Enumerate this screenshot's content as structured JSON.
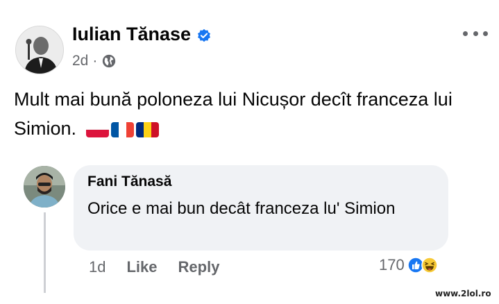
{
  "post": {
    "author": "Iulian Tănase",
    "time": "2d",
    "separator": "·",
    "text": "Mult mai bună poloneza lui Nicușor decît franceza lui Simion.",
    "flags": [
      "flag-poland-icon",
      "flag-france-icon",
      "flag-romania-icon"
    ]
  },
  "comment": {
    "author": "Fani Tănasă",
    "text": "Orice e mai bun decât franceza lu' Simion",
    "time": "1d",
    "like_label": "Like",
    "reply_label": "Reply",
    "reaction_count": "170",
    "reaction_icons": [
      "like-reaction-icon",
      "haha-reaction-icon"
    ]
  },
  "watermark": "www.2lol.ro",
  "colors": {
    "verified_blue": "#1877f2",
    "secondary_text": "#65676b",
    "bubble_bg": "#f0f2f5"
  }
}
